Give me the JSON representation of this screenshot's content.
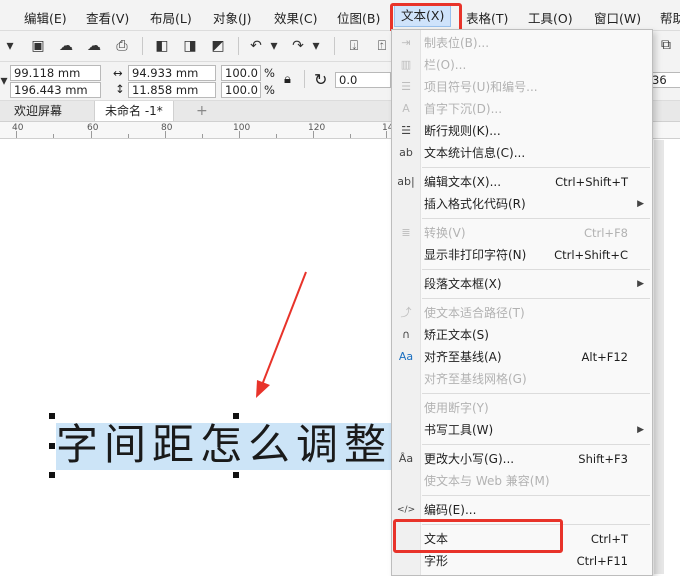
{
  "menubar": {
    "items": [
      {
        "id": "edit",
        "label": "编辑(E)"
      },
      {
        "id": "view",
        "label": "查看(V)"
      },
      {
        "id": "layout",
        "label": "布局(L)"
      },
      {
        "id": "object",
        "label": "对象(J)"
      },
      {
        "id": "effects",
        "label": "效果(C)"
      },
      {
        "id": "bitmap",
        "label": "位图(B)"
      },
      {
        "id": "text",
        "label": "文本(X)"
      },
      {
        "id": "table",
        "label": "表格(T)"
      },
      {
        "id": "tools",
        "label": "工具(O)"
      },
      {
        "id": "window",
        "label": "窗口(W)"
      },
      {
        "id": "help",
        "label": "帮助"
      }
    ]
  },
  "propbar": {
    "x": "99.118 mm",
    "y": "196.443 mm",
    "width": "94.933 mm",
    "height": "11.858 mm",
    "scale_w": "100.0",
    "scale_h": "100.0",
    "percent": "%",
    "rotation": "0.0",
    "font_size": "36"
  },
  "tabs": [
    "欢迎屏幕",
    "未命名 -1*",
    "+"
  ],
  "ruler": {
    "labels": [
      "40",
      "60",
      "80",
      "100",
      "120",
      "14"
    ]
  },
  "canvas": {
    "text": "字间距怎么调整"
  },
  "text_menu": {
    "items": [
      {
        "label": "制表位(B)...",
        "shortcut": "",
        "disabled": true,
        "icon": "tab-stops-icon",
        "glyph": "⇥"
      },
      {
        "label": "栏(O)...",
        "shortcut": "",
        "disabled": true,
        "icon": "columns-icon",
        "glyph": "▥"
      },
      {
        "label": "项目符号(U)和编号...",
        "shortcut": "",
        "disabled": true,
        "icon": "bullets-icon",
        "glyph": "☰"
      },
      {
        "label": "首字下沉(D)...",
        "shortcut": "",
        "disabled": true,
        "icon": "drop-cap-icon",
        "glyph": "A"
      },
      {
        "label": "断行规则(K)...",
        "shortcut": "",
        "disabled": false,
        "icon": "line-break-rules-icon",
        "glyph": "☱"
      },
      {
        "label": "文本统计信息(C)...",
        "shortcut": "",
        "disabled": false,
        "icon": "text-statistics-icon",
        "glyph": "ab"
      },
      {
        "label": "编辑文本(X)...",
        "shortcut": "Ctrl+Shift+T",
        "disabled": false,
        "icon": "edit-text-icon",
        "glyph": "ab|"
      },
      {
        "label": "插入格式化代码(R)",
        "shortcut": "",
        "disabled": false,
        "icon": "",
        "glyph": "",
        "submenu": true
      },
      {
        "label": "转换(V)",
        "shortcut": "Ctrl+F8",
        "disabled": true,
        "icon": "convert-text-icon",
        "glyph": "≣"
      },
      {
        "label": "显示非打印字符(N)",
        "shortcut": "Ctrl+Shift+C",
        "disabled": false,
        "icon": "",
        "glyph": ""
      },
      {
        "label": "段落文本框(X)",
        "shortcut": "",
        "disabled": false,
        "icon": "",
        "glyph": "",
        "submenu": true
      },
      {
        "label": "使文本适合路径(T)",
        "shortcut": "",
        "disabled": true,
        "icon": "fit-text-to-path-icon",
        "glyph": "⤴"
      },
      {
        "label": "矫正文本(S)",
        "shortcut": "",
        "disabled": false,
        "icon": "straighten-text-icon",
        "glyph": "∩"
      },
      {
        "label": "对齐至基线(A)",
        "shortcut": "Alt+F12",
        "disabled": false,
        "icon": "align-baseline-icon",
        "glyph": "Aa"
      },
      {
        "label": "对齐至基线网格(G)",
        "shortcut": "",
        "disabled": true,
        "icon": "",
        "glyph": ""
      },
      {
        "label": "使用断字(Y)",
        "shortcut": "",
        "disabled": true,
        "icon": "",
        "glyph": ""
      },
      {
        "label": "书写工具(W)",
        "shortcut": "",
        "disabled": false,
        "icon": "",
        "glyph": "",
        "submenu": true
      },
      {
        "label": "更改大小写(G)...",
        "shortcut": "Shift+F3",
        "disabled": false,
        "icon": "change-case-icon",
        "glyph": "Ȃa"
      },
      {
        "label": "使文本与 Web 兼容(M)",
        "shortcut": "",
        "disabled": true,
        "icon": "",
        "glyph": ""
      },
      {
        "label": "编码(E)...",
        "shortcut": "",
        "disabled": false,
        "icon": "encoding-icon",
        "glyph": "</>"
      },
      {
        "label": "文本",
        "shortcut": "Ctrl+T",
        "disabled": false,
        "icon": "",
        "glyph": ""
      },
      {
        "label": "字形",
        "shortcut": "Ctrl+F11",
        "disabled": false,
        "icon": "",
        "glyph": ""
      }
    ]
  },
  "colors": {
    "highlight_red": "#e8332a",
    "selection_blue": "#cce4f7",
    "menu_active": "#cfe3fb"
  }
}
